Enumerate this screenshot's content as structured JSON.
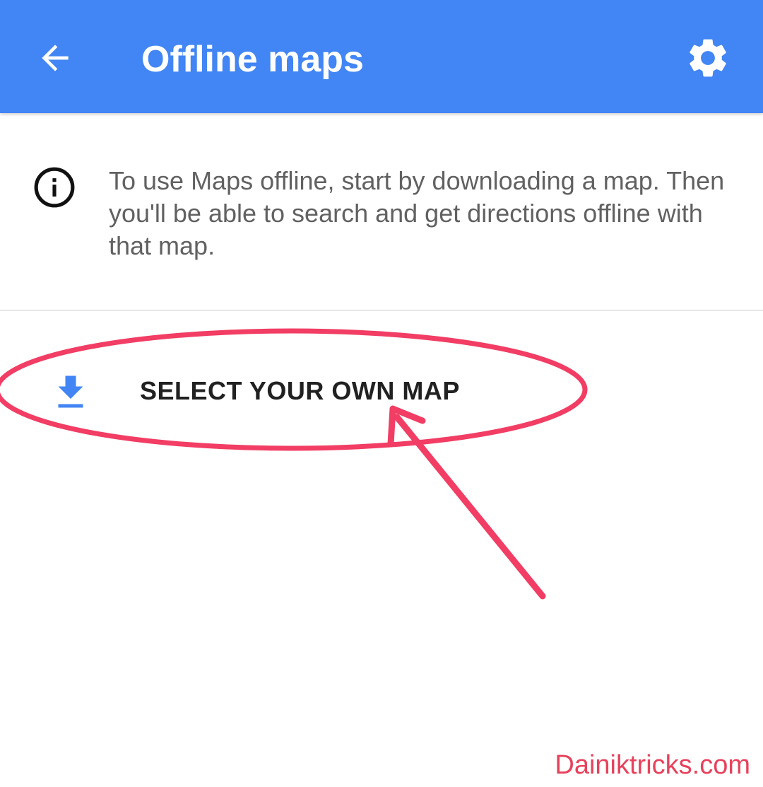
{
  "app_bar": {
    "title": "Offline maps",
    "background_color": "#4285f4",
    "back_icon": "arrow-left-icon",
    "settings_icon": "gear-icon"
  },
  "info": {
    "icon": "info-icon",
    "text": "To use Maps offline, start by downloading a map. Then you'll be able to search and get directions offline with that map."
  },
  "select_map": {
    "icon": "download-icon",
    "label": "SELECT YOUR OWN MAP",
    "icon_color": "#4285f4"
  },
  "annotation": {
    "color": "#f23d64"
  },
  "watermark": {
    "text": "Dainiktricks.com"
  }
}
